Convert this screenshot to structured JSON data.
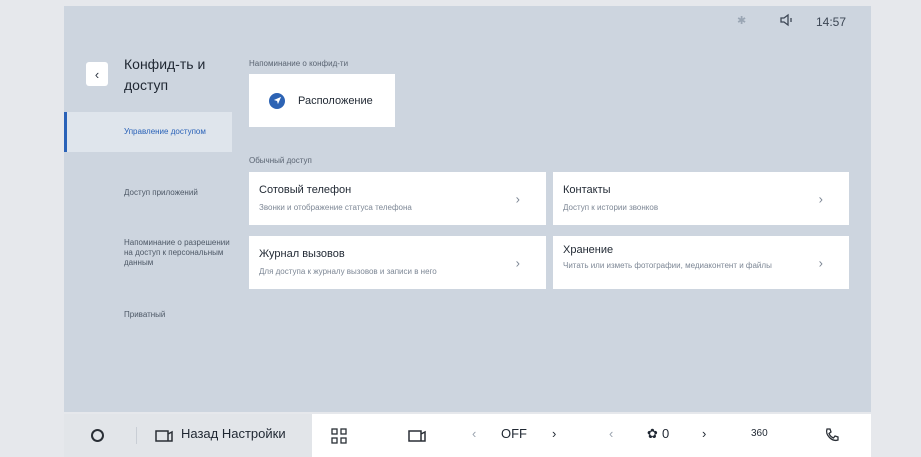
{
  "status": {
    "time": "14:57",
    "bluetooth_icon": "bluetooth-icon",
    "volume_icon": "volume-icon"
  },
  "header": {
    "back_icon": "chevron-left-icon",
    "title": "Конфид-ть и доступ"
  },
  "sidebar": {
    "items": [
      {
        "label": "Управление доступом",
        "active": true
      },
      {
        "label": "Доступ приложений",
        "active": false
      },
      {
        "label": "Напоминание о разрешении на доступ к персональным данным",
        "active": false
      },
      {
        "label": "Приватный",
        "active": false
      }
    ]
  },
  "privacy_reminder": {
    "section_label": "Напоминание о конфид-ти",
    "location_label": "Расположение",
    "location_icon": "navigation-arrow-icon"
  },
  "regular_access": {
    "section_label": "Обычный доступ",
    "cards": [
      {
        "title": "Сотовый телефон",
        "subtitle": "Звонки и отображение статуса телефона"
      },
      {
        "title": "Контакты",
        "subtitle": "Доступ к истории звонков"
      },
      {
        "title": "Журнал вызовов",
        "subtitle": "Для доступа к журналу вызовов и записи в него"
      },
      {
        "title": "Хранение",
        "subtitle": "Читать или изметь фотографии, медиаконтент и файлы"
      }
    ]
  },
  "bottombar": {
    "back_settings_label": "Назад Настройки",
    "climate_mode": "OFF",
    "fan_speed": "0",
    "view360_label": "360",
    "accent_color": "#2a62b8"
  }
}
